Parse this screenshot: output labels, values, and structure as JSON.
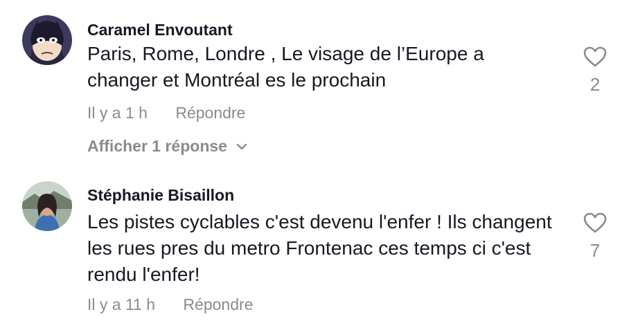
{
  "comments": [
    {
      "username": "Caramel Envoutant",
      "text": "Paris, Rome, Londre , Le visage de l’Europe a changer et Montréal es le prochain",
      "time": "Il y a 1 h",
      "reply_label": "Répondre",
      "likes": "2",
      "view_replies": "Afficher 1 réponse",
      "avatar": "masked-cartoon-avatar"
    },
    {
      "username": "Stéphanie Bisaillon",
      "text": "Les pistes cyclables c'est devenu l'enfer ! Ils changent les rues pres du metro Frontenac ces temps ci c'est rendu l'enfer!",
      "time": "Il y a 11 h",
      "reply_label": "Répondre",
      "likes": "7",
      "avatar": "photo-avatar"
    }
  ],
  "icons": {
    "like": "heart-outline-icon",
    "expand": "chevron-down-icon"
  }
}
